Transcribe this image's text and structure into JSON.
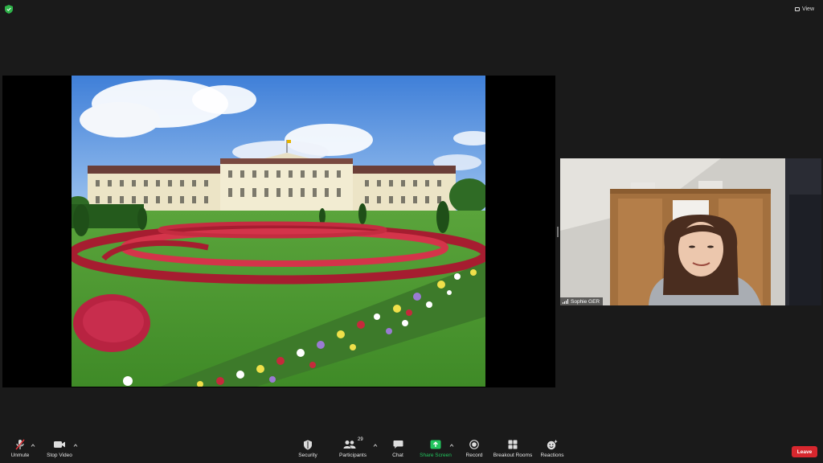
{
  "top_bar": {
    "security_icon": "shield-check-icon",
    "view_label": "View"
  },
  "shared_screen": {
    "description_icon": "shared-photo"
  },
  "participant_video": {
    "name": "Sophie GER"
  },
  "toolbar": {
    "unmute_label": "Unmute",
    "stop_video_label": "Stop Video",
    "security_label": "Security",
    "participants_label": "Participants",
    "participants_count": "29",
    "chat_label": "Chat",
    "share_screen_label": "Share Screen",
    "record_label": "Record",
    "breakout_rooms_label": "Breakout Rooms",
    "reactions_label": "Reactions",
    "leave_label": "Leave"
  },
  "colors": {
    "background": "#1a1a1a",
    "share_screen_green": "#22c55e",
    "leave_red": "#d8272e",
    "muted_red": "#e0343a"
  }
}
